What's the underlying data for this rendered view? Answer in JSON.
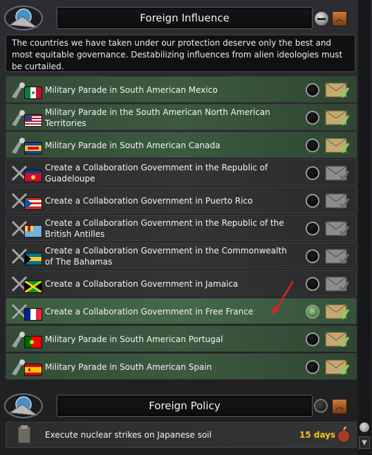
{
  "panel": {
    "title": "Foreign Influence",
    "description": "The countries we have taken under our protection deserve only the best and most equitable governance. Destabilizing influences from alien ideologies must be curtailed."
  },
  "decisions": [
    {
      "label": "Military Parade in South American Mexico",
      "flag": "mexico",
      "state": "available",
      "selected": false
    },
    {
      "label": "Military Parade in the South American North American Territories",
      "flag": "usa",
      "state": "available",
      "selected": false
    },
    {
      "label": "Military Parade in South American Canada",
      "flag": "canada",
      "state": "available",
      "selected": false
    },
    {
      "label": "Create a Collaboration Government in the Republic of Guadeloupe",
      "flag": "guadeloupe",
      "state": "unavailable",
      "selected": false
    },
    {
      "label": "Create a Collaboration Government in Puerto Rico",
      "flag": "puerto-rico",
      "state": "unavailable",
      "selected": false
    },
    {
      "label": "Create a Collaboration Government in the Republic of the British Antilles",
      "flag": "british-antilles",
      "state": "unavailable",
      "selected": false
    },
    {
      "label": "Create a Collaboration Government in the Commonwealth of The Bahamas",
      "flag": "bahamas",
      "state": "unavailable",
      "selected": false
    },
    {
      "label": "Create a Collaboration Government in Jamaica",
      "flag": "jamaica",
      "state": "unavailable",
      "selected": false
    },
    {
      "label": "Create a Collaboration Government in Free France",
      "flag": "france",
      "state": "available",
      "selected": true
    },
    {
      "label": "Military Parade in South American Portugal",
      "flag": "portugal",
      "state": "available",
      "selected": false
    },
    {
      "label": "Military Parade in South American Spain",
      "flag": "spain",
      "state": "available",
      "selected": false
    }
  ],
  "foreign_policy": {
    "title": "Foreign Policy",
    "mission": {
      "label": "Execute nuclear strikes on Japanese soil",
      "days": "15 days"
    }
  },
  "colors": {
    "available_row": "#3c5a40",
    "unavailable_row": "#333436",
    "days_text": "#f5c518",
    "annotation_arrow": "#e02020"
  }
}
